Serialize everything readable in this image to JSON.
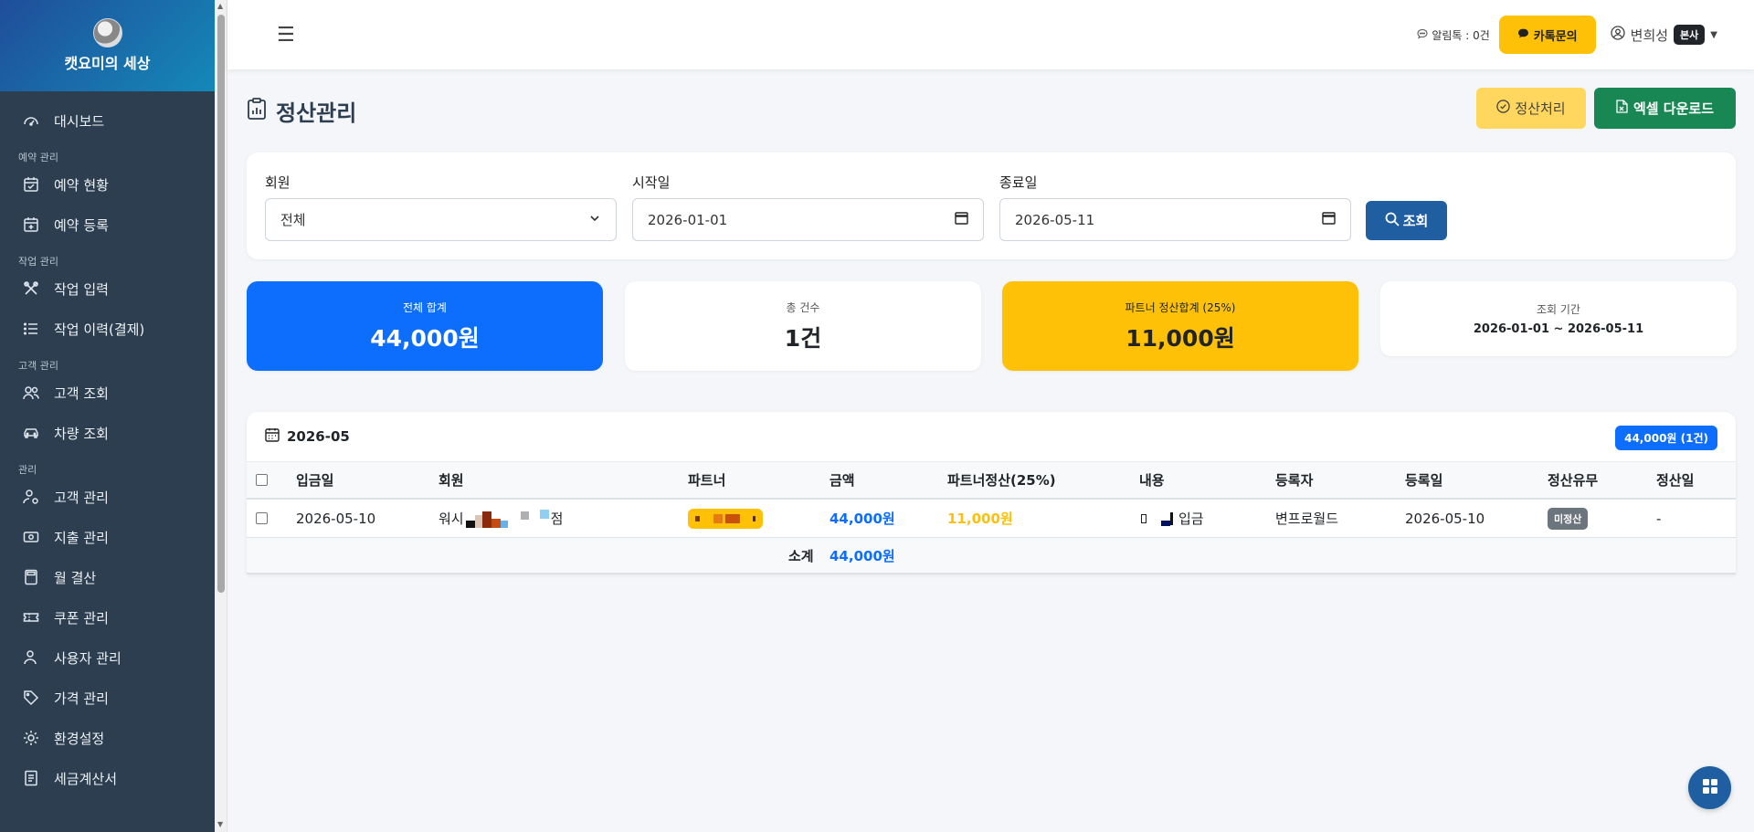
{
  "sidebar": {
    "brand": "캣요미의 세상",
    "items": [
      {
        "label": "대시보드"
      },
      {
        "section": "예약 관리"
      },
      {
        "label": "예약 현황"
      },
      {
        "label": "예약 등록"
      },
      {
        "section": "작업 관리"
      },
      {
        "label": "작업 입력"
      },
      {
        "label": "작업 이력(결제)"
      },
      {
        "section": "고객 관리"
      },
      {
        "label": "고객 조회"
      },
      {
        "label": "차량 조회"
      },
      {
        "section": "관리"
      },
      {
        "label": "고객 관리"
      },
      {
        "label": "지출 관리"
      },
      {
        "label": "월 결산"
      },
      {
        "label": "쿠폰 관리"
      },
      {
        "label": "사용자 관리"
      },
      {
        "label": "가격 관리"
      },
      {
        "label": "환경설정"
      },
      {
        "label": "세금계산서"
      }
    ]
  },
  "topbar": {
    "alimtalk": "알림톡 : 0건",
    "kakao_button": "카톡문의",
    "user_name": "변희성",
    "user_badge": "본사"
  },
  "page": {
    "title": "정산관리",
    "settle_button": "정산처리",
    "excel_button": "엑셀 다운로드"
  },
  "filter": {
    "member_label": "회원",
    "member_value": "전체",
    "start_label": "시작일",
    "start_value": "2026-01-01",
    "end_label": "종료일",
    "end_value": "2026-05-11",
    "search_button": "조회"
  },
  "stats": {
    "total_label": "전체 합계",
    "total_value": "44,000원",
    "count_label": "총 건수",
    "count_value": "1건",
    "partner_label": "파트너 정산합계 (25%)",
    "partner_value": "11,000원",
    "period_label": "조회 기간",
    "period_value": "2026-01-01 ~ 2026-05-11"
  },
  "table": {
    "month": "2026-05",
    "month_badge": "44,000원 (1건)",
    "headers": [
      "입금일",
      "회원",
      "파트너",
      "금액",
      "파트너정산(25%)",
      "내용",
      "등록자",
      "등록일",
      "정산유무",
      "정산일"
    ],
    "rows": [
      {
        "date": "2026-05-10",
        "member_prefix": "워시",
        "member_suffix": "점",
        "partner": "",
        "amount": "44,000원",
        "partner_amount": "11,000원",
        "content": "입금",
        "registrar": "변프로월드",
        "reg_date": "2026-05-10",
        "status": "미정산",
        "settle_date": "-"
      }
    ],
    "subtotal_label": "소계",
    "subtotal_value": "44,000원"
  },
  "colors": {
    "sidebar_bg": "#2c3e50",
    "primary": "#0d6efd",
    "warning": "#ffc107",
    "success": "#198754",
    "search": "#1f5ea0"
  }
}
